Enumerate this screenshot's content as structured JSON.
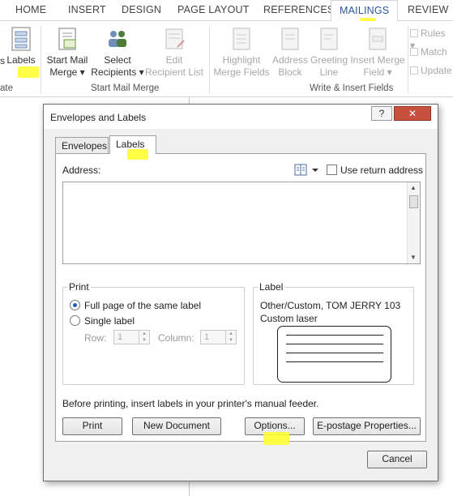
{
  "ribbon": {
    "tabs": [
      "HOME",
      "INSERT",
      "DESIGN",
      "PAGE LAYOUT",
      "REFERENCES",
      "MAILINGS",
      "REVIEW"
    ],
    "active_tab": "MAILINGS",
    "labels_btn": "Labels",
    "create_group_fragment": "ate",
    "labels_prefix_glyph": "s",
    "start_mail_merge": [
      "Start Mail",
      "Merge ▾"
    ],
    "select_recipients": [
      "Select",
      "Recipients ▾"
    ],
    "edit_recipient_list": [
      "Edit",
      "Recipient List"
    ],
    "start_mail_merge_group": "Start Mail Merge",
    "highlight_merge_fields": [
      "Highlight",
      "Merge Fields"
    ],
    "address_block": [
      "Address",
      "Block"
    ],
    "greeting_line": [
      "Greeting",
      "Line"
    ],
    "insert_merge_field": [
      "Insert Merge",
      "Field ▾"
    ],
    "write_insert_group": "Write & Insert Fields",
    "rules": "Rules ▾",
    "match": "Match",
    "update": "Update"
  },
  "dialog": {
    "title": "Envelopes and Labels",
    "help": "?",
    "close": "✕",
    "tabs": {
      "envelopes": "Envelopes",
      "labels": "Labels"
    },
    "address_label": "Address:",
    "use_return_address": "Use return address",
    "address_value": "",
    "print_group": {
      "legend": "Print",
      "full_page": "Full page of the same label",
      "single_label": "Single label",
      "row_label": "Row:",
      "row_value": "1",
      "column_label": "Column:",
      "column_value": "1",
      "selected": "full_page"
    },
    "label_group": {
      "legend": "Label",
      "vendor": "Other/Custom, TOM JERRY 103",
      "type": "Custom laser"
    },
    "hint": "Before printing, insert labels in your printer's manual feeder.",
    "buttons": {
      "print": "Print",
      "new_document": "New Document",
      "options": "Options...",
      "epostage": "E-postage Properties...",
      "cancel": "Cancel"
    }
  },
  "colors": {
    "highlight": "#ffff33",
    "accent": "#2b579a",
    "close_button": "#c7503f",
    "radio_dot": "#1e5fb4"
  }
}
